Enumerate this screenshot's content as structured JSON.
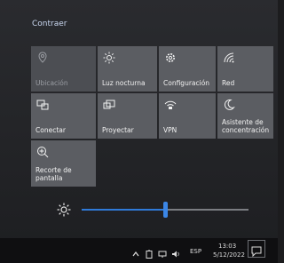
{
  "header": {
    "collapse_label": "Contraer"
  },
  "tiles": [
    {
      "label": "Ubicación",
      "icon": "location-icon"
    },
    {
      "label": "Luz nocturna",
      "icon": "night-light-icon"
    },
    {
      "label": "Configuración",
      "icon": "gear-icon"
    },
    {
      "label": "Red",
      "icon": "network-icon"
    },
    {
      "label": "Conectar",
      "icon": "connect-icon"
    },
    {
      "label": "Proyectar",
      "icon": "project-icon"
    },
    {
      "label": "VPN",
      "icon": "vpn-icon"
    },
    {
      "label": "Asistente de concentración",
      "icon": "moon-icon"
    },
    {
      "label": "Recorte de pantalla",
      "icon": "snip-icon"
    }
  ],
  "brightness": {
    "icon": "brightness-icon",
    "level_fraction": 0.5
  },
  "taskbar": {
    "language": "ESP",
    "time": "13:03",
    "date": "5/12/2022"
  },
  "colors": {
    "accent": "#2f7ad8",
    "tile": "#5b5d62"
  }
}
